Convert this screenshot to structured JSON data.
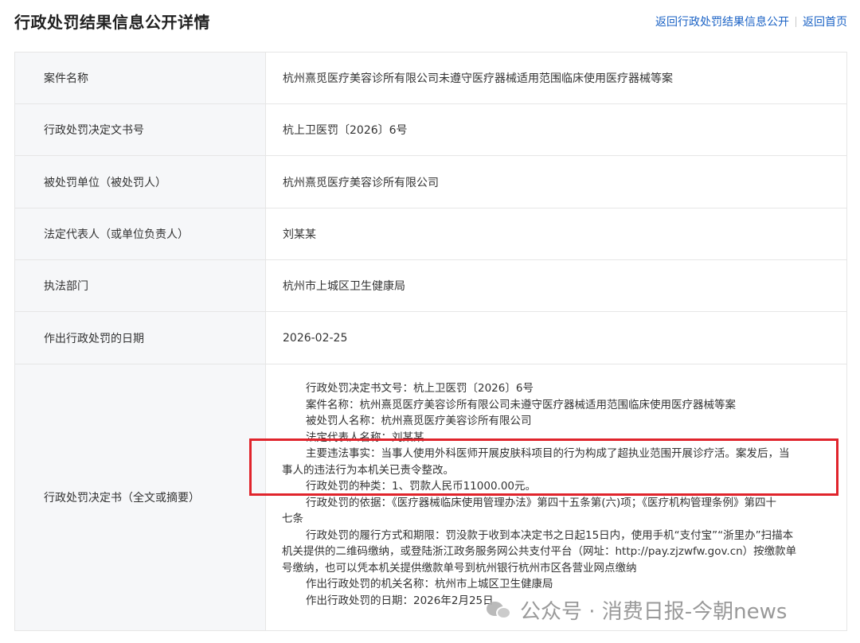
{
  "header": {
    "title": "行政处罚结果信息公开详情",
    "nav_back_list": "返回行政处罚结果信息公开",
    "nav_home": "返回首页"
  },
  "rows": [
    {
      "label": "案件名称",
      "value": "杭州熹觅医疗美容诊所有限公司未遵守医疗器械适用范围临床使用医疗器械等案"
    },
    {
      "label": "行政处罚决定文书号",
      "value": "杭上卫医罚〔2026〕6号"
    },
    {
      "label": "被处罚单位（被处罚人）",
      "value": "杭州熹觅医疗美容诊所有限公司"
    },
    {
      "label": "法定代表人（或单位负责人）",
      "value": "刘某某"
    },
    {
      "label": "执法部门",
      "value": "杭州市上城区卫生健康局"
    },
    {
      "label": "作出行政处罚的日期",
      "value": "2026-02-25"
    }
  ],
  "decision": {
    "label": "行政处罚决定书（全文或摘要）",
    "lines": [
      "行政处罚决定书文号：杭上卫医罚〔2026〕6号",
      "案件名称：杭州熹觅医疗美容诊所有限公司未遵守医疗器械适用范围临床使用医疗器械等案",
      "被处罚人名称：杭州熹觅医疗美容诊所有限公司",
      "法定代表人名称：刘某某",
      "主要违法事实：当事人使用外科医师开展皮肤科项目的行为构成了超执业范围开展诊疗活。案发后，当",
      "事人的违法行为本机关已责令整改。",
      "行政处罚的种类：1、罚款人民币11000.00元。",
      "行政处罚的依据：《医疗器械临床使用管理办法》第四十五条第(六)项；《医疗机构管理条例》第四十",
      "七条",
      "行政处罚的履行方式和期限：罚没款于收到本决定书之日起15日内，使用手机“支付宝”“浙里办”扫描本",
      "机关提供的二维码缴纳，或登陆浙江政务服务网公共支付平台（网址：http://pay.zjzwfw.gov.cn）按缴款单",
      "号缴纳，也可以凭本机关提供缴款单号到杭州银行杭州市区各营业网点缴纳",
      "作出行政处罚的机关名称：杭州市上城区卫生健康局",
      "作出行政处罚的日期：2026年2月25日"
    ]
  },
  "watermark": {
    "text": "公众号 · 消费日报-今朝news",
    "icon": "wechat-icon"
  },
  "colors": {
    "link": "#1a62c5",
    "highlight": "#e0242c",
    "label_bg": "#f6f7f9"
  }
}
